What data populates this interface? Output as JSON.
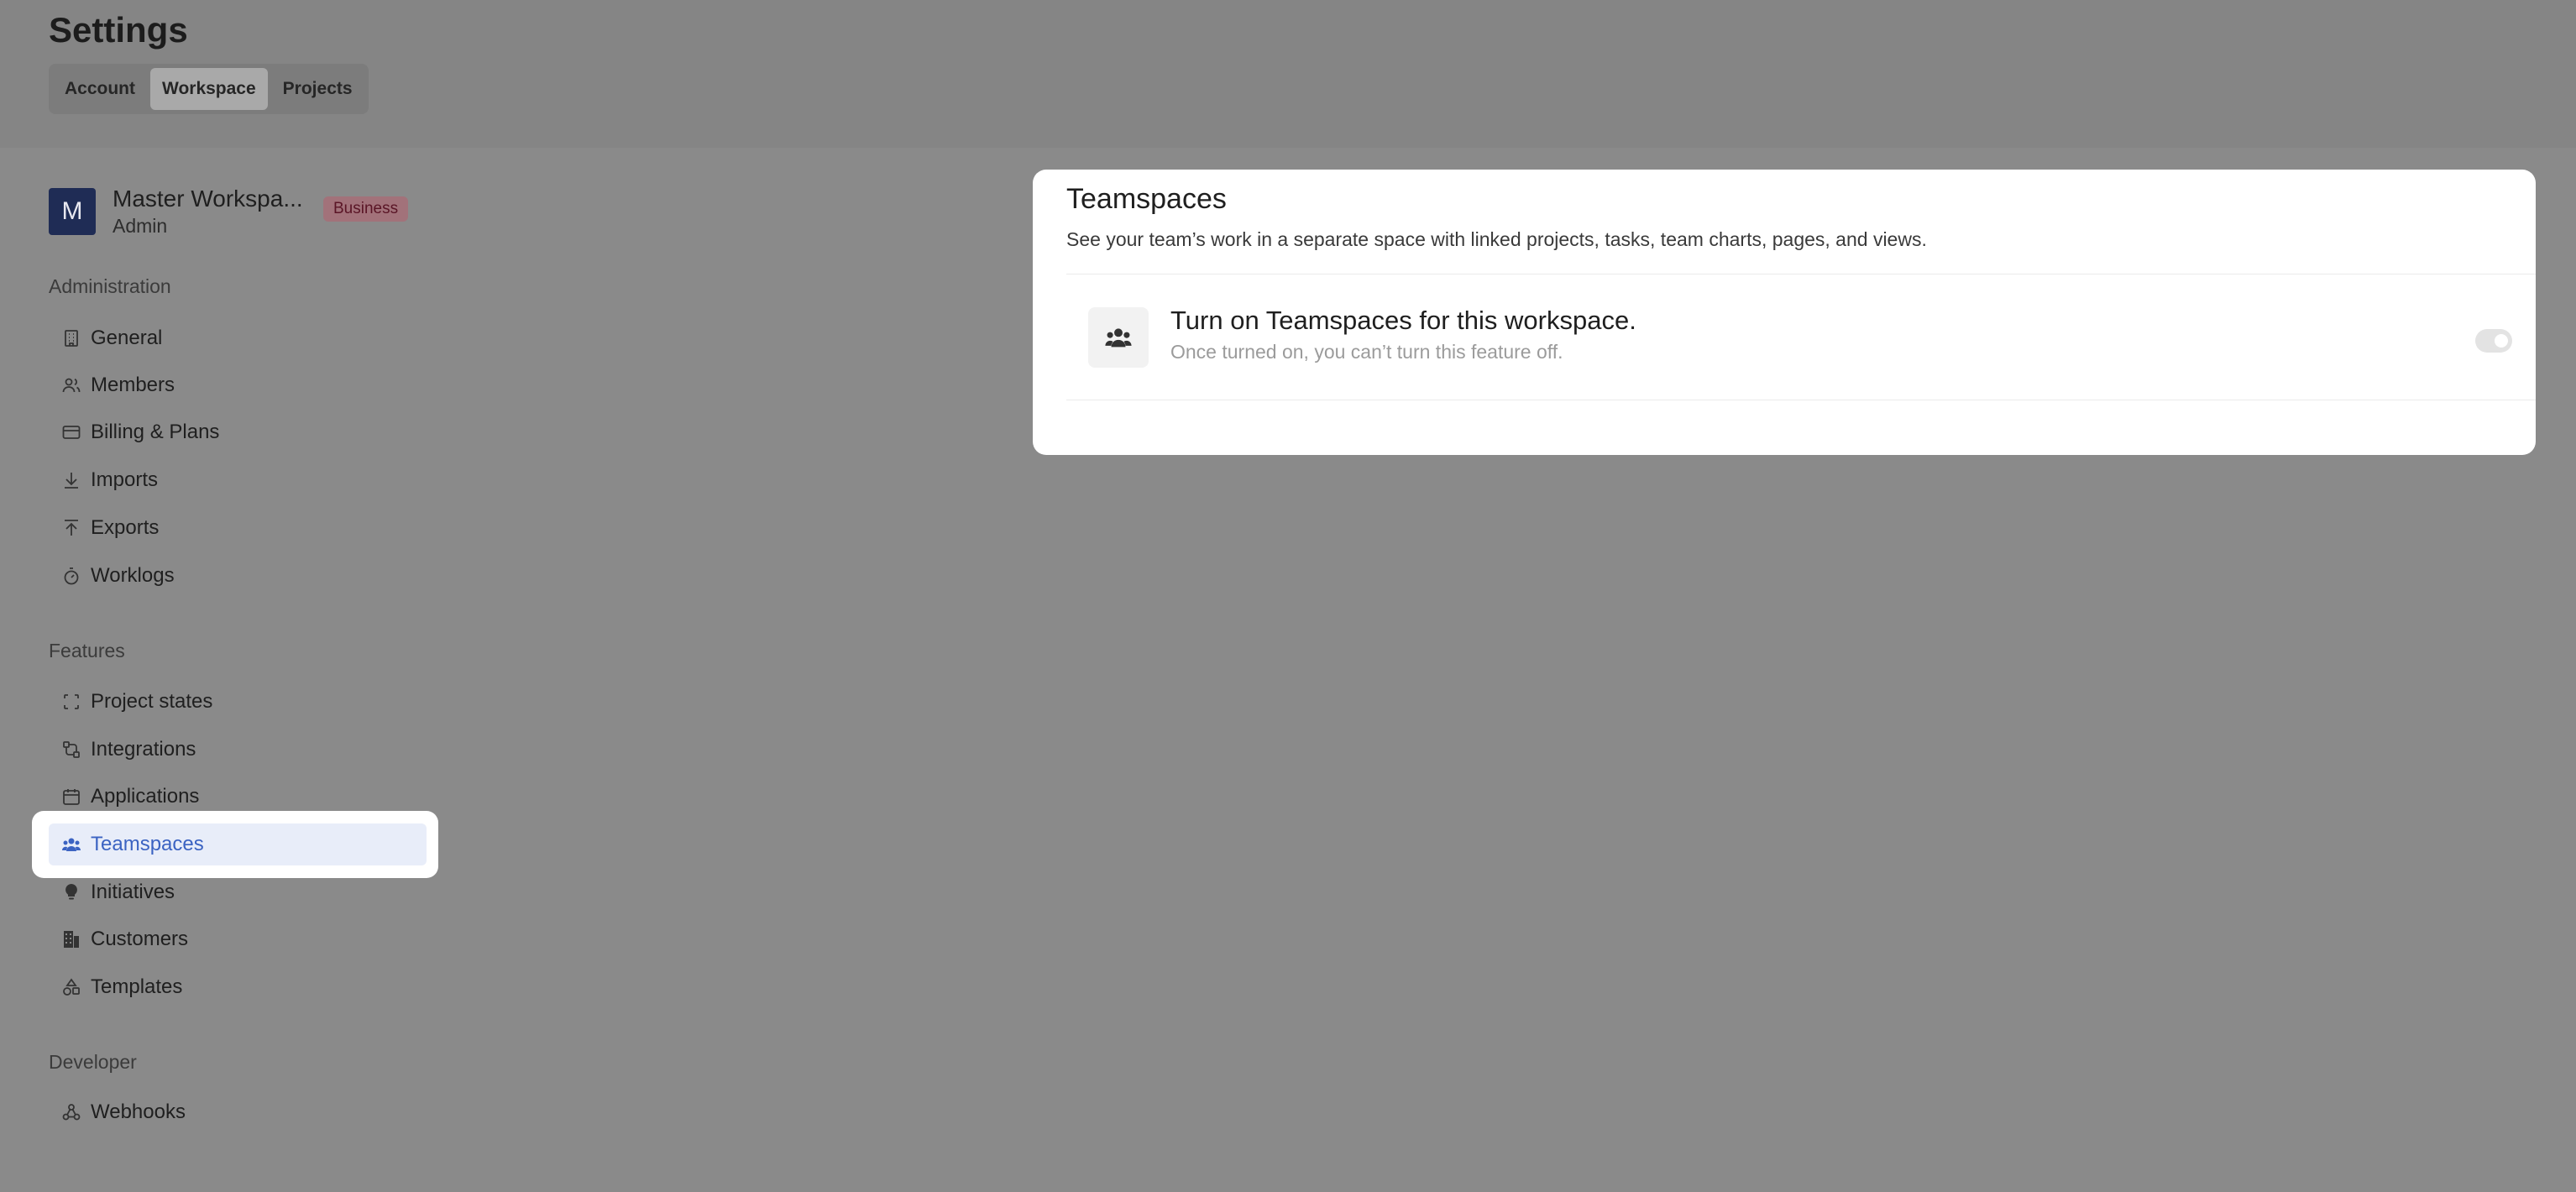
{
  "header": {
    "title": "Settings",
    "tabs": [
      {
        "label": "Account"
      },
      {
        "label": "Workspace"
      },
      {
        "label": "Projects"
      }
    ],
    "active_tab": "Workspace"
  },
  "workspace": {
    "avatar_letter": "M",
    "name": "Master Workspa...",
    "role": "Admin",
    "badge": "Business"
  },
  "sidebar": {
    "sections": [
      {
        "title": "Administration",
        "items": [
          {
            "label": "General",
            "icon": "building-icon"
          },
          {
            "label": "Members",
            "icon": "users-icon"
          },
          {
            "label": "Billing & Plans",
            "icon": "credit-card-icon"
          },
          {
            "label": "Imports",
            "icon": "download-icon"
          },
          {
            "label": "Exports",
            "icon": "upload-icon"
          },
          {
            "label": "Worklogs",
            "icon": "timer-icon"
          }
        ]
      },
      {
        "title": "Features",
        "items": [
          {
            "label": "Project states",
            "icon": "dashed-square-icon"
          },
          {
            "label": "Integrations",
            "icon": "integrations-icon"
          },
          {
            "label": "Applications",
            "icon": "calendar-icon"
          },
          {
            "label": "Teamspaces",
            "icon": "teamspaces-icon",
            "active": true
          },
          {
            "label": "Initiatives",
            "icon": "lightbulb-icon"
          },
          {
            "label": "Customers",
            "icon": "customers-icon"
          },
          {
            "label": "Templates",
            "icon": "shapes-icon"
          }
        ]
      },
      {
        "title": "Developer",
        "items": [
          {
            "label": "Webhooks",
            "icon": "webhook-icon"
          }
        ]
      }
    ]
  },
  "main": {
    "title": "Teamspaces",
    "description": "See your team’s work in a separate space with linked projects, tasks, team charts, pages, and views.",
    "feature": {
      "title": "Turn on Teamspaces for this workspace.",
      "subtitle": "Once turned on, you can’t turn this feature off.",
      "toggle_on": false
    }
  },
  "colors": {
    "active_item_bg": "#e8edf9",
    "active_item_text": "#3b63c2",
    "avatar_bg": "#1f2c55",
    "badge_bg": "#a2727a"
  }
}
